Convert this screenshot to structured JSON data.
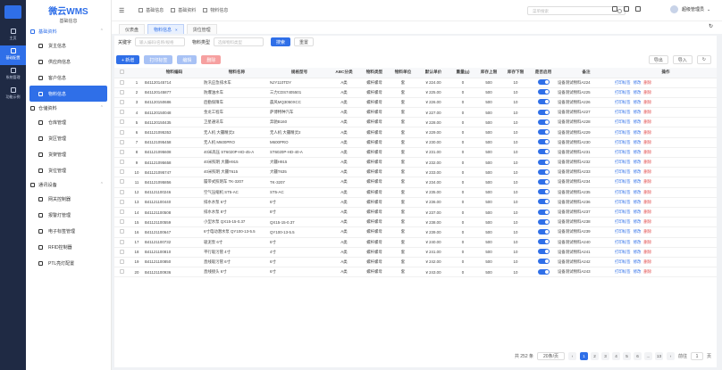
{
  "app": {
    "title": "微云WMS",
    "subtitle": "基础信息"
  },
  "rail": [
    {
      "label": "主页"
    },
    {
      "label": "基础配置"
    },
    {
      "label": "系统管理"
    },
    {
      "label": "功能示例"
    }
  ],
  "sidebar": {
    "groups": [
      {
        "label": "基础资料",
        "items": [
          "货主信息",
          "供应商信息",
          "客户信息",
          "物料信息"
        ]
      },
      {
        "label": "仓储资料",
        "items": [
          "仓库管理",
          "货区管理",
          "货架管理",
          "货位管理"
        ]
      },
      {
        "label": "通讯设备",
        "items": [
          "网关控制器",
          "报警灯管理",
          "电子标签管理",
          "RFID控制器",
          "PTL亮灯配置"
        ]
      }
    ]
  },
  "header": {
    "crumbs": [
      "基础信息",
      "基础资料",
      "物料信息"
    ],
    "search_placeholder": "菜单搜索",
    "user": "超级管理员"
  },
  "tabs": [
    {
      "label": "仪表盘"
    },
    {
      "label": "物料信息",
      "close": "×"
    },
    {
      "label": "货位管理"
    }
  ],
  "filter": {
    "code_label": "关键字",
    "code_placeholder": "输入编码/名称/规格",
    "type_label": "物料类型",
    "type_placeholder": "选择物料类型",
    "search_btn": "搜索",
    "reset_btn": "重置"
  },
  "toolbar": {
    "add": "+ 新增",
    "b2": "打印标签",
    "b3": "编辑",
    "b4": "删除",
    "export": "导出",
    "import": "导入"
  },
  "table": {
    "headers": [
      "",
      "",
      "物料编码",
      "物料名称",
      "规格型号",
      "ABC分类",
      "物料类型",
      "物料单位",
      "默认单价",
      "重量(g)",
      "库存上限",
      "库存下限",
      "是否启用",
      "备注",
      "操作"
    ],
    "ops": [
      "打印标签",
      "修改",
      "删除"
    ],
    "rows": [
      [
        "1",
        "B41120145714",
        "防汛应急排水车",
        "NJY110TDY",
        "A类",
        "螺杆螺母",
        "套",
        "¥ 224.00",
        "0",
        "500",
        "10",
        "设备测试物料A224"
      ],
      [
        "2",
        "B41120145877",
        "防爆油水车",
        "三力CDS7405501",
        "A类",
        "螺杆螺母",
        "套",
        "¥ 225.00",
        "0",
        "500",
        "10",
        "设备测试物料A225"
      ],
      [
        "3",
        "B41120150686",
        "后勤保障车",
        "晨风MQ3050XCC",
        "A类",
        "螺杆螺母",
        "套",
        "¥ 226.00",
        "0",
        "500",
        "10",
        "设备测试物料A226"
      ],
      [
        "4",
        "B41120150048",
        "金龙工程车",
        "萨博特种汽车",
        "A类",
        "螺杆螺母",
        "套",
        "¥ 227.00",
        "0",
        "500",
        "10",
        "设备测试物料A227"
      ],
      [
        "5",
        "B41120150435",
        "卫星通讯车",
        "奔驰B160",
        "A类",
        "螺杆螺母",
        "套",
        "¥ 228.00",
        "0",
        "500",
        "10",
        "设备测试物料A228"
      ],
      [
        "6",
        "B41121095353",
        "无人机 大疆精灵2",
        "无人机 大疆精灵2",
        "A类",
        "螺杆螺母",
        "套",
        "¥ 229.00",
        "0",
        "500",
        "10",
        "设备测试物料A229"
      ],
      [
        "7",
        "B41121095458",
        "无人机 M600PRO",
        "M600PRO",
        "A类",
        "螺杆螺母",
        "套",
        "¥ 230.00",
        "0",
        "500",
        "10",
        "设备测试物料A230"
      ],
      [
        "8",
        "B41121095608",
        "40米高压 ST6020P-HD-45-A",
        "ST6020P-HD-40-A",
        "A类",
        "螺杆螺母",
        "套",
        "¥ 231.00",
        "0",
        "500",
        "10",
        "设备测试物料A231"
      ],
      [
        "9",
        "B41121095658",
        "40米照明 大疆H915",
        "大疆H915",
        "A类",
        "螺杆螺母",
        "套",
        "¥ 232.00",
        "0",
        "500",
        "10",
        "设备测试物料A232"
      ],
      [
        "10",
        "B41121095747",
        "40米照明 大疆T615",
        "大疆T635",
        "A类",
        "螺杆螺母",
        "套",
        "¥ 233.00",
        "0",
        "500",
        "10",
        "设备测试物料A233"
      ],
      [
        "11",
        "B41121095856",
        "履带式照明车 TK-3207",
        "TK-3207",
        "A类",
        "螺杆螺母",
        "套",
        "¥ 234.00",
        "0",
        "500",
        "10",
        "设备测试物料A234"
      ],
      [
        "12",
        "B41121100246",
        "空气压缩机 ST5-AC",
        "ST5-AC",
        "A类",
        "螺杆螺母",
        "套",
        "¥ 235.00",
        "0",
        "500",
        "10",
        "设备测试物料A235"
      ],
      [
        "13",
        "B41121100440",
        "排水水泵 6寸",
        "6寸",
        "A类",
        "螺杆螺母",
        "套",
        "¥ 236.00",
        "0",
        "500",
        "10",
        "设备测试物料A236"
      ],
      [
        "14",
        "B41121100508",
        "排水水泵 8寸",
        "8寸",
        "A类",
        "螺杆螺母",
        "套",
        "¥ 237.00",
        "0",
        "500",
        "10",
        "设备测试物料A237"
      ],
      [
        "15",
        "B41121100559",
        "小型水泵 QX15-15-0.37",
        "QX15-15-0.37",
        "A类",
        "螺杆螺母",
        "套",
        "¥ 238.00",
        "0",
        "500",
        "10",
        "设备测试物料A238"
      ],
      [
        "16",
        "B41121100647",
        "6寸电动潜水泵 QY100-13-5.5",
        "QY100-13-5.5",
        "A类",
        "螺杆螺母",
        "套",
        "¥ 239.00",
        "0",
        "500",
        "10",
        "设备测试物料A239"
      ],
      [
        "17",
        "B41121100732",
        "吸泥泵 6寸",
        "6寸",
        "A类",
        "螺杆螺母",
        "套",
        "¥ 240.00",
        "0",
        "500",
        "10",
        "设备测试物料A240"
      ],
      [
        "18",
        "B41121100810",
        "平行吸污管 4寸",
        "4寸",
        "A类",
        "螺杆螺母",
        "套",
        "¥ 241.00",
        "0",
        "500",
        "10",
        "设备测试物料A241"
      ],
      [
        "19",
        "B41121100850",
        "直线吸污管 6寸",
        "6寸",
        "A类",
        "螺杆螺母",
        "套",
        "¥ 242.00",
        "0",
        "500",
        "10",
        "设备测试物料A242"
      ],
      [
        "20",
        "B41121100936",
        "直线接头 6寸",
        "6寸",
        "A类",
        "螺杆螺母",
        "套",
        "¥ 243.00",
        "0",
        "500",
        "10",
        "设备测试物料A243"
      ]
    ]
  },
  "pager": {
    "total": "共 252 条",
    "size": "20条/页",
    "pages": [
      "1",
      "2",
      "3",
      "4",
      "5",
      "6",
      "...",
      "13"
    ],
    "prev": "‹",
    "next": "›",
    "goto": "前往",
    "page_no": "1",
    "unit": "页"
  }
}
